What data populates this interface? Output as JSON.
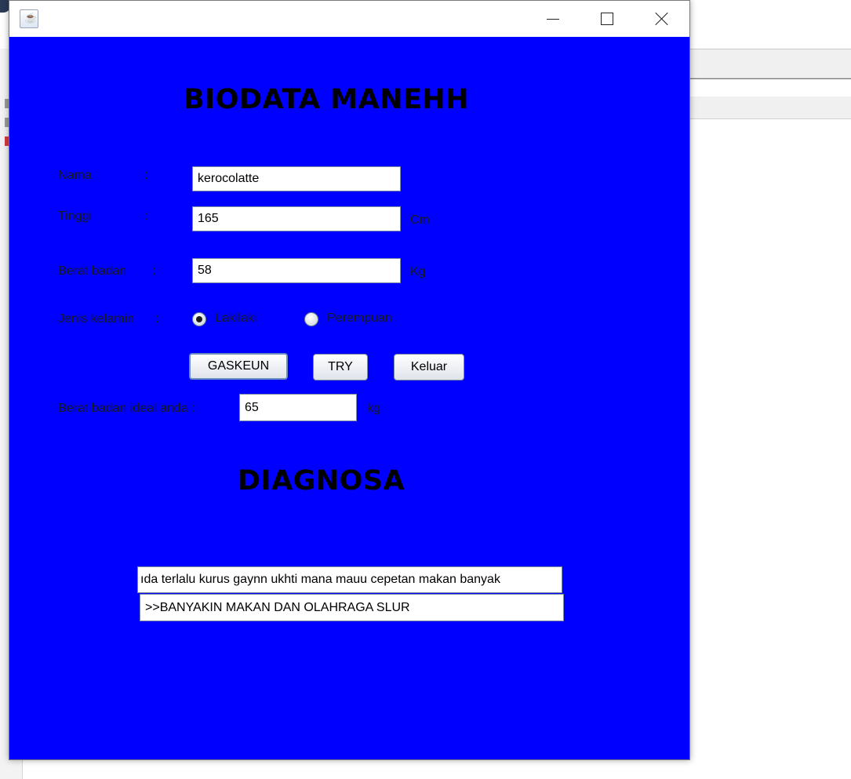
{
  "window": {
    "icon": "java-icon"
  },
  "form": {
    "title": "BIODATA MANEHH",
    "nama": {
      "label": "Nama",
      "colon": ":",
      "value": "kerocolatte"
    },
    "tinggi": {
      "label": "Tinggi",
      "colon": ":",
      "value": "165",
      "unit": "Cm"
    },
    "berat": {
      "label": "Berat badan",
      "colon": ":",
      "value": "58",
      "unit": "Kg"
    },
    "jenis_kelamin": {
      "label": "Jenis kelamin",
      "colon": ":",
      "options": [
        {
          "label": "Lakilaki",
          "checked": true
        },
        {
          "label": "Perempuan",
          "checked": false
        }
      ]
    },
    "buttons": {
      "gaskeun": "GASKEUN",
      "try": "TRY",
      "keluar": "Keluar"
    },
    "ideal": {
      "label": "Berat badan ideal anda :",
      "value": "65",
      "unit": "kg"
    }
  },
  "diagnosa": {
    "title": "DIAGNOSA",
    "line1": "ıda terlalu kurus gaynn ukhti mana mauu cepetan makan banyak",
    "line2": ">>BANYAKIN MAKAN DAN OLAHRAGA SLUR"
  },
  "colors": {
    "window_bg": "#0000ff",
    "heading": "#000000",
    "label": "#1a1a1a"
  }
}
